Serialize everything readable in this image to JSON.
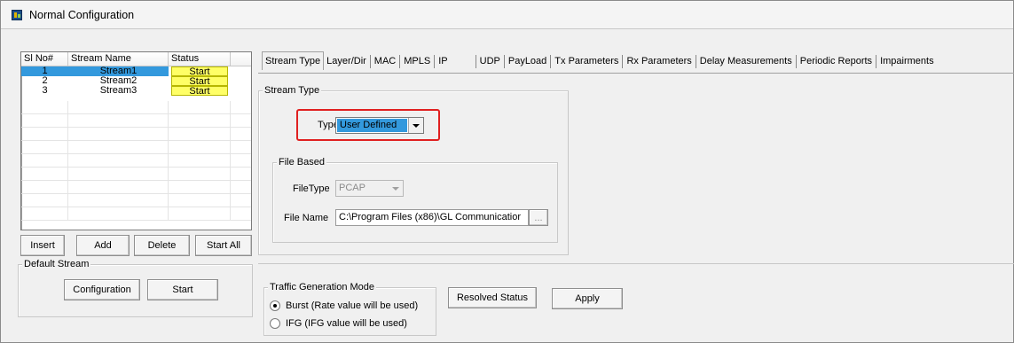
{
  "window": {
    "title": "Normal Configuration"
  },
  "stream_list": {
    "headers": [
      "Sl No#",
      "Stream Name",
      "Status"
    ],
    "rows": [
      {
        "no": "1",
        "name": "Stream1",
        "status": "Start",
        "selected": true
      },
      {
        "no": "2",
        "name": "Stream2",
        "status": "Start",
        "selected": false
      },
      {
        "no": "3",
        "name": "Stream3",
        "status": "Start",
        "selected": false
      }
    ]
  },
  "list_buttons": {
    "insert": "Insert",
    "add": "Add",
    "delete": "Delete",
    "start_all": "Start All"
  },
  "default_stream": {
    "label": "Default Stream",
    "configuration": "Configuration",
    "start": "Start"
  },
  "tabs": [
    "Stream Type",
    "Layer/Dir",
    "MAC",
    "MPLS",
    "IP",
    "UDP",
    "PayLoad",
    "Tx Parameters",
    "Rx Parameters",
    "Delay Measurements",
    "Periodic Reports",
    "Impairments"
  ],
  "stream_type": {
    "group_label": "Stream Type",
    "type_label": "Type",
    "type_value": "User Defined",
    "file_based": {
      "group_label": "File Based",
      "filetype_label": "FileType",
      "filetype_value": "PCAP",
      "filename_label": "File Name",
      "filename_value": "C:\\Program Files (x86)\\GL Communicatior",
      "browse_label": "..."
    }
  },
  "traffic_generation": {
    "group_label": "Traffic Generation Mode",
    "options": [
      "Burst (Rate value will be used)",
      "IFG (IFG value will be used)"
    ],
    "selected_index": 0
  },
  "bottom_buttons": {
    "resolved_status": "Resolved Status",
    "apply": "Apply"
  },
  "colors": {
    "selection": "#3399dd",
    "status_bg": "#ffff66",
    "highlight": "#e02020"
  }
}
